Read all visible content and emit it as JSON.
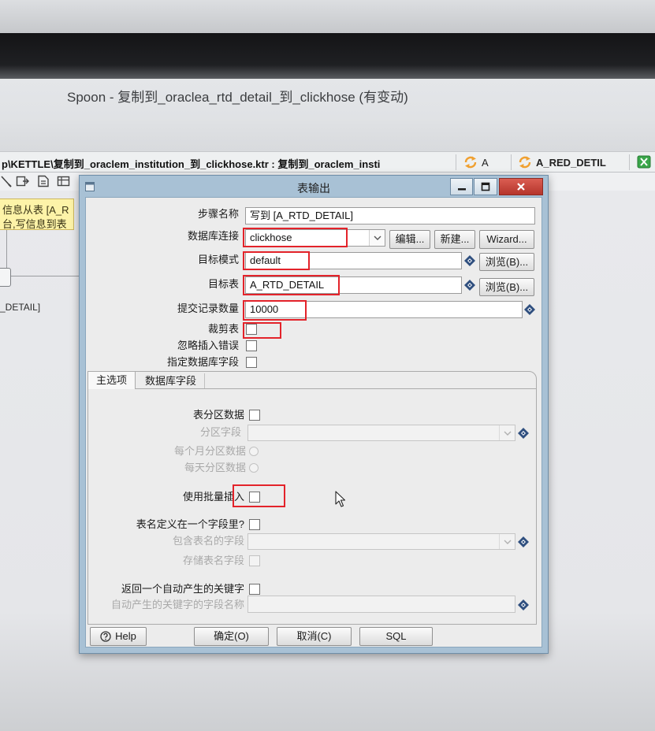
{
  "window": {
    "title": "Spoon - 复制到_oraclea_rtd_detail_到_clickhose (有变动)"
  },
  "file_tab": {
    "path": "p\\KETTLE\\复制到_oraclem_institution_到_clickhose.ktr : 复制到_oraclem_insti"
  },
  "other_tabs": [
    {
      "label": "A",
      "icon": "transformation-icon"
    },
    {
      "label": "A_RED_DETIL",
      "icon": "transformation-icon"
    }
  ],
  "canvas": {
    "tooltip_lines": [
      "信息从表 [A_R",
      "台,写信息到表"
    ],
    "step_label": "_DETAIL]"
  },
  "dialog": {
    "title": "表输出",
    "window_controls": [
      "minimize-icon",
      "maximize-icon",
      "close-icon"
    ],
    "step_name": {
      "label": "步骤名称",
      "value": "写到 [A_RTD_DETAIL]"
    },
    "connection": {
      "label": "数据库连接",
      "value": "clickhose",
      "edit_button": "编辑...",
      "new_button": "新建...",
      "wizard_button": "Wizard...",
      "highlighted": true
    },
    "target_schema": {
      "label": "目标模式",
      "value": "default",
      "browse_button": "浏览(B)...",
      "highlighted": true
    },
    "target_table": {
      "label": "目标表",
      "value": "A_RTD_DETAIL",
      "browse_button": "浏览(B)...",
      "highlighted": true
    },
    "commit_size": {
      "label": "提交记录数量",
      "value": "10000",
      "highlighted": true
    },
    "truncate_table": {
      "label": "裁剪表",
      "checked": false,
      "highlighted": true
    },
    "ignore_insert_errors": {
      "label": "忽略插入错误",
      "checked": false
    },
    "specify_db_fields": {
      "label": "指定数据库字段",
      "checked": false
    },
    "tabs": [
      {
        "label": "主选项",
        "active": true
      },
      {
        "label": "数据库字段",
        "active": false
      }
    ],
    "main_options": {
      "partition": {
        "label": "表分区数据",
        "checked": false
      },
      "partition_field": {
        "label": "分区字段",
        "enabled": false
      },
      "partition_monthly": {
        "label": "每个月分区数据",
        "selected": false,
        "enabled": false
      },
      "partition_daily": {
        "label": "每天分区数据",
        "selected": false,
        "enabled": false
      },
      "batch_insert": {
        "label": "使用批量插入",
        "checked": false,
        "highlighted": true
      },
      "tablename_in_field": {
        "label": "表名定义在一个字段里?",
        "checked": false
      },
      "tablename_field": {
        "label": "包含表名的字段",
        "enabled": false
      },
      "store_tablename": {
        "label": "存储表名字段",
        "checked": false,
        "enabled": false
      },
      "return_key": {
        "label": "返回一个自动产生的关键字",
        "checked": false
      },
      "key_field_name": {
        "label": "自动产生的关键字的字段名称",
        "enabled": false
      }
    },
    "buttons": {
      "help": "Help",
      "ok": "确定(O)",
      "cancel": "取消(C)",
      "sql": "SQL"
    }
  },
  "colors": {
    "annotation_red": "#e3232a",
    "dialog_frame": "#a8c1d5",
    "close_button": "#c9453c",
    "tooltip_background": "#fdf3a8",
    "variable_icon": "#2f4f7f",
    "tab_icon": "#f0a030"
  }
}
